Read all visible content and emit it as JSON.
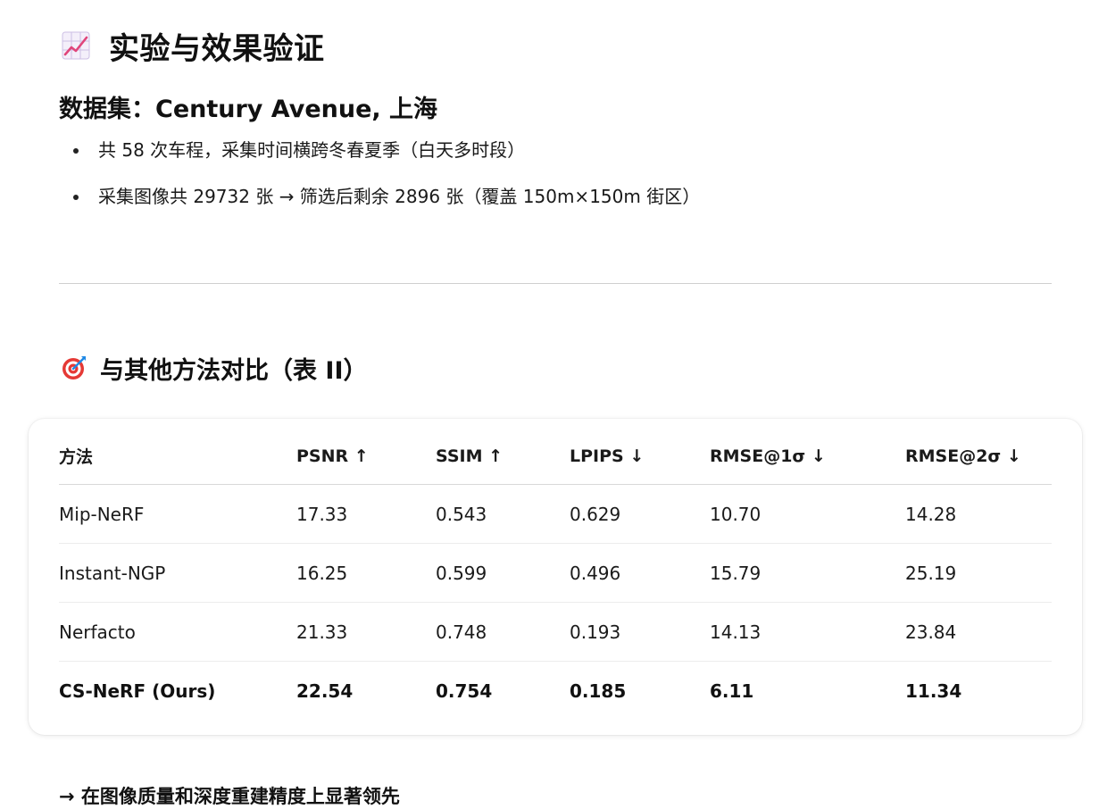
{
  "section1": {
    "icon": "chart-increasing-icon",
    "title": "实验与效果验证",
    "dataset_heading": "数据集：Century Avenue, 上海",
    "bullets": [
      "共 58 次车程，采集时间横跨冬春夏季（白天多时段）",
      "采集图像共 29732 张 → 筛选后剩余 2896 张（覆盖 150m×150m 街区）"
    ]
  },
  "section2": {
    "icon": "target-icon",
    "title": "与其他方法对比（表 II）"
  },
  "table": {
    "headers": [
      "方法",
      "PSNR ↑",
      "SSIM ↑",
      "LPIPS ↓",
      "RMSE@1σ ↓",
      "RMSE@2σ ↓"
    ],
    "rows": [
      [
        "Mip-NeRF",
        "17.33",
        "0.543",
        "0.629",
        "10.70",
        "14.28"
      ],
      [
        "Instant-NGP",
        "16.25",
        "0.599",
        "0.496",
        "15.79",
        "25.19"
      ],
      [
        "Nerfacto",
        "21.33",
        "0.748",
        "0.193",
        "14.13",
        "23.84"
      ],
      [
        "CS-NeRF (Ours)",
        "22.54",
        "0.754",
        "0.185",
        "6.11",
        "11.34"
      ]
    ]
  },
  "conclusion": "→ 在图像质量和深度重建精度上显著领先",
  "colors": {
    "icon_chart_line": "#e0457b",
    "icon_chart_grid": "#b9a8d6",
    "target_red": "#e53935",
    "target_blue": "#1e88e5"
  }
}
